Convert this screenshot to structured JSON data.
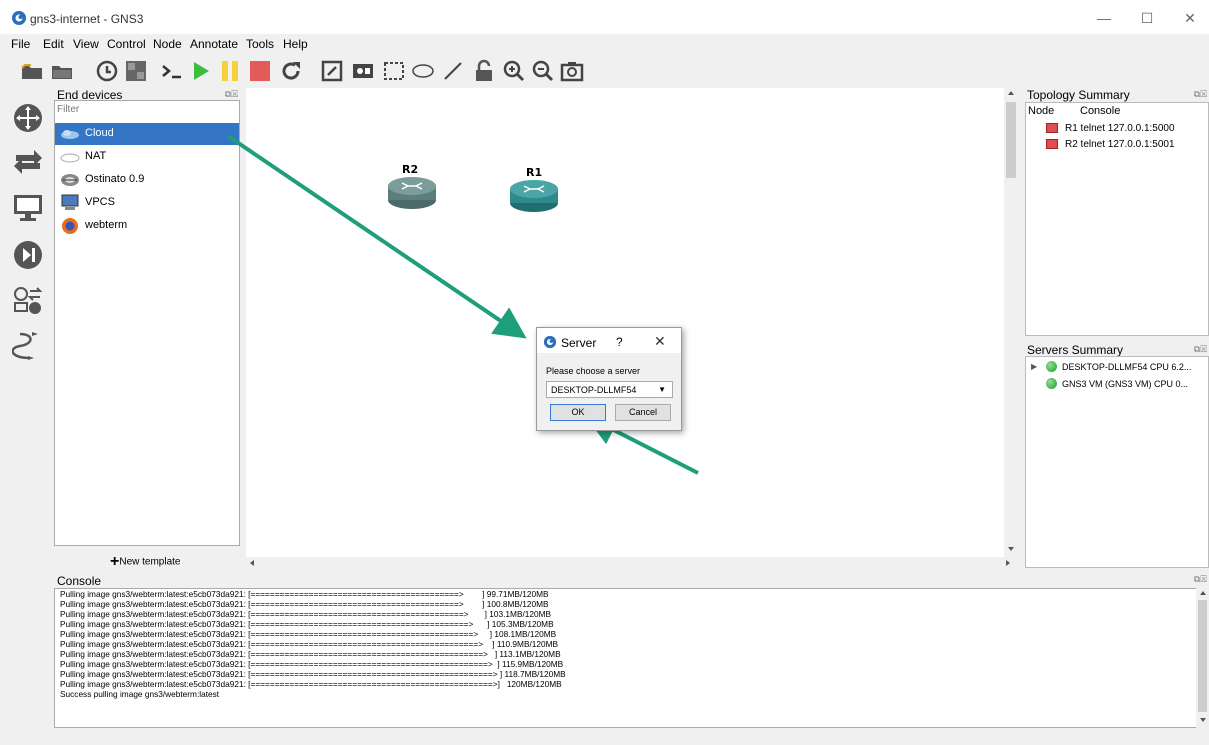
{
  "window": {
    "title": "gns3-internet - GNS3",
    "minimize": "—",
    "maximize": "☐",
    "close": "✕"
  },
  "menu": [
    "File",
    "Edit",
    "View",
    "Control",
    "Node",
    "Annotate",
    "Tools",
    "Help"
  ],
  "toolbar_icons": [
    "open-folder-icon",
    "folder-icon",
    "snapshot-clock-icon",
    "show-interface-labels-icon",
    "console-all-icon",
    "start-all-icon",
    "suspend-all-icon",
    "stop-all-icon",
    "reload-all-icon",
    "add-note-icon",
    "insert-picture-icon",
    "draw-rectangle-icon",
    "draw-ellipse-icon",
    "draw-line-icon",
    "lock-icon",
    "zoom-in-icon",
    "zoom-out-icon",
    "screenshot-icon"
  ],
  "dock_icons": [
    "routers-icon",
    "switches-icon",
    "end-devices-icon",
    "security-devices-icon",
    "all-devices-icon",
    "add-link-icon"
  ],
  "devices_panel": {
    "title": "End devices",
    "filter_placeholder": "Filter",
    "items": [
      {
        "label": "Cloud",
        "icon": "cloud-icon",
        "selected": true
      },
      {
        "label": "NAT",
        "icon": "nat-icon",
        "selected": false
      },
      {
        "label": "Ostinato 0.9",
        "icon": "ostinato-icon",
        "selected": false
      },
      {
        "label": "VPCS",
        "icon": "vpcs-icon",
        "selected": false
      },
      {
        "label": "webterm",
        "icon": "firefox-icon",
        "selected": false
      }
    ],
    "new_template": "New template"
  },
  "canvas": {
    "routers": [
      {
        "label": "R2",
        "color": "#5e7d7d"
      },
      {
        "label": "R1",
        "color": "#2e8a8a"
      }
    ]
  },
  "dialog": {
    "title": "Server",
    "help": "?",
    "close": "✕",
    "prompt": "Please choose a server",
    "selected_server": "DESKTOP-DLLMF54",
    "ok": "OK",
    "cancel": "Cancel"
  },
  "topology": {
    "title": "Topology Summary",
    "col_node": "Node",
    "col_console": "Console",
    "rows": [
      "R1 telnet 127.0.0.1:5000",
      "R2 telnet 127.0.0.1:5001"
    ]
  },
  "servers": {
    "title": "Servers Summary",
    "rows": [
      "DESKTOP-DLLMF54 CPU 6.2...",
      "GNS3 VM (GNS3 VM) CPU 0..."
    ]
  },
  "console": {
    "title": "Console",
    "lines": [
      "Pulling image gns3/webterm:latest:e5cb073da921: [===========================================>        ] 99.71MB/120MB",
      "Pulling image gns3/webterm:latest:e5cb073da921: [===========================================>        ] 100.8MB/120MB",
      "Pulling image gns3/webterm:latest:e5cb073da921: [============================================>       ] 103.1MB/120MB",
      "Pulling image gns3/webterm:latest:e5cb073da921: [=============================================>      ] 105.3MB/120MB",
      "Pulling image gns3/webterm:latest:e5cb073da921: [==============================================>     ] 108.1MB/120MB",
      "Pulling image gns3/webterm:latest:e5cb073da921: [===============================================>    ] 110.9MB/120MB",
      "Pulling image gns3/webterm:latest:e5cb073da921: [================================================>   ] 113.1MB/120MB",
      "Pulling image gns3/webterm:latest:e5cb073da921: [=================================================>  ] 115.9MB/120MB",
      "Pulling image gns3/webterm:latest:e5cb073da921: [==================================================> ] 118.7MB/120MB",
      "Pulling image gns3/webterm:latest:e5cb073da921: [==================================================>]   120MB/120MB",
      "Success pulling image gns3/webterm:latest"
    ]
  },
  "colors": {
    "selection": "#3476c5",
    "annotation_arrow": "#1e9e7a"
  }
}
